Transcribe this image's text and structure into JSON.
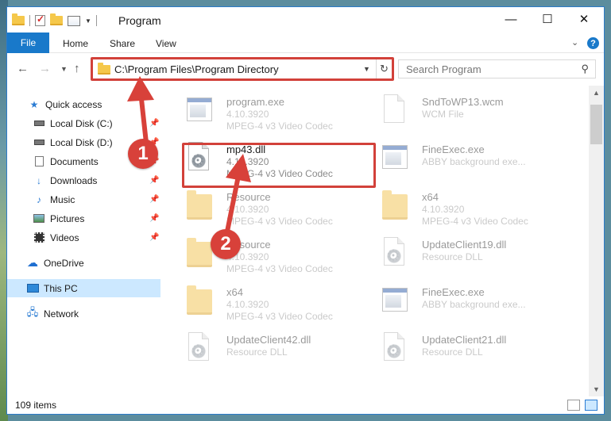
{
  "window": {
    "title": "Program",
    "controls": {
      "minimize": "—",
      "maximize": "☐",
      "close": "✕"
    }
  },
  "ribbon": {
    "file": "File",
    "tabs": [
      "Home",
      "Share",
      "View"
    ],
    "help": "?"
  },
  "address": {
    "path": "C:\\Program Files\\Program Directory",
    "search_placeholder": "Search Program"
  },
  "nav": {
    "items": [
      {
        "label": "Quick access",
        "icon": "star-icon"
      },
      {
        "label": "Local Disk (C:)",
        "icon": "drive-icon"
      },
      {
        "label": "Local Disk (D:)",
        "icon": "drive-icon"
      },
      {
        "label": "Documents",
        "icon": "documents-icon"
      },
      {
        "label": "Downloads",
        "icon": "download-icon"
      },
      {
        "label": "Music",
        "icon": "music-icon"
      },
      {
        "label": "Pictures",
        "icon": "pictures-icon"
      },
      {
        "label": "Videos",
        "icon": "videos-icon"
      },
      {
        "label": "OneDrive",
        "icon": "cloud-icon"
      },
      {
        "label": "This PC",
        "icon": "computer-icon"
      },
      {
        "label": "Network",
        "icon": "network-icon"
      }
    ],
    "selected": "This PC"
  },
  "files": [
    {
      "name": "program.exe",
      "line2": "4.10.3920",
      "line3": "MPEG-4 v3 Video Codec",
      "icon": "installer-icon"
    },
    {
      "name": "SndToWP13.wcm",
      "line2": "WCM File",
      "line3": "",
      "icon": "document-icon"
    },
    {
      "name": "mp43.dll",
      "line2": "4.10.3920",
      "line3": "MPEG-4 v3 Video Codec",
      "icon": "dll-icon"
    },
    {
      "name": "FineExec.exe",
      "line2": "ABBY background exe...",
      "line3": "",
      "icon": "exe-icon"
    },
    {
      "name": "Resource",
      "line2": "4.10.3920",
      "line3": "MPEG-4 v3 Video Codec",
      "icon": "folder-icon"
    },
    {
      "name": "x64",
      "line2": "4.10.3920",
      "line3": "MPEG-4 v3 Video Codec",
      "icon": "folder-icon"
    },
    {
      "name": "Resource",
      "line2": "4.10.3920",
      "line3": "MPEG-4 v3 Video Codec",
      "icon": "folder-icon"
    },
    {
      "name": "UpdateClient19.dll",
      "line2": "Resource DLL",
      "line3": "",
      "icon": "dll-icon"
    },
    {
      "name": "x64",
      "line2": "4.10.3920",
      "line3": "MPEG-4 v3 Video Codec",
      "icon": "folder-icon"
    },
    {
      "name": "FineExec.exe",
      "line2": "ABBY background exe...",
      "line3": "",
      "icon": "exe-icon"
    },
    {
      "name": "UpdateClient42.dll",
      "line2": "Resource DLL",
      "line3": "",
      "icon": "dll-icon"
    },
    {
      "name": "UpdateClient21.dll",
      "line2": "Resource DLL",
      "line3": "",
      "icon": "dll-icon"
    }
  ],
  "annotations": {
    "marker1": "1",
    "marker2": "2",
    "color": "#d2413a"
  },
  "status": {
    "count": "109 items"
  }
}
